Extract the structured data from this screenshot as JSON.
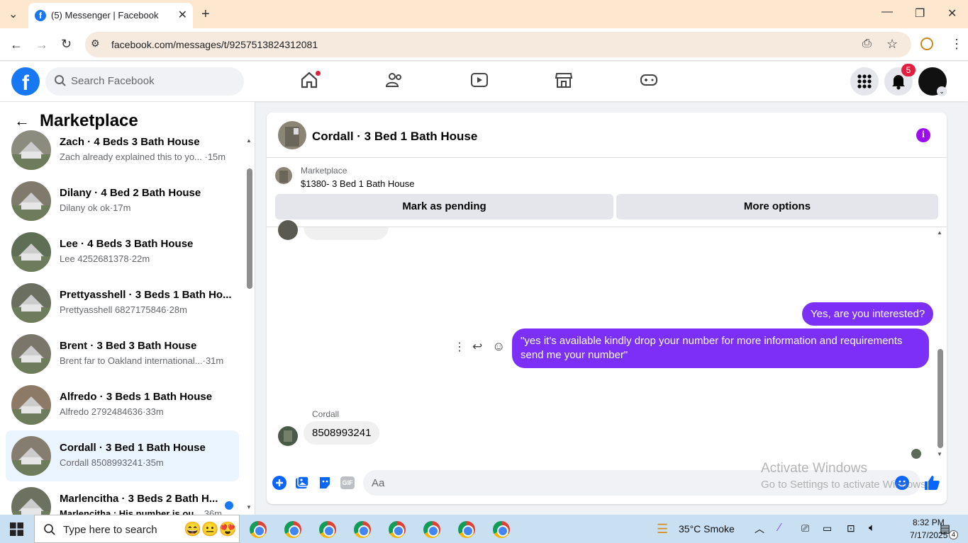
{
  "browser": {
    "tab_title": "(5) Messenger | Facebook",
    "url": "facebook.com/messages/t/9257513824312081"
  },
  "fb": {
    "search_placeholder": "Search Facebook",
    "notification_count": "5"
  },
  "sidebar": {
    "title": "Marketplace",
    "conversations": [
      {
        "name": "Zach · 4 Beds 3 Bath House",
        "preview": "Zach already explained this to yo... ·15m"
      },
      {
        "name": "Dilany · 4 Bed 2 Bath House",
        "preview": "Dilany ok ok·17m"
      },
      {
        "name": "Lee · 4 Beds 3 Bath House",
        "preview": "Lee 4252681378·22m"
      },
      {
        "name": "Prettyasshell · 3 Beds 1 Bath Ho...",
        "preview": "Prettyasshell 6827175846·28m"
      },
      {
        "name": "Brent · 3 Bed 3 Bath House",
        "preview": "Brent far to Oakland international...·31m"
      },
      {
        "name": "Alfredo · 3 Beds 1 Bath House",
        "preview": "Alfredo 2792484636·33m"
      },
      {
        "name": "Cordall · 3 Bed 1 Bath House",
        "preview": "Cordall 8508993241·35m"
      },
      {
        "name": "Marlencitha · 3 Beds 2 Bath H...",
        "preview": "Marlencitha : His number is ou...",
        "time": "36m"
      }
    ]
  },
  "chat": {
    "title": "Cordall · 3 Bed 1 Bath House",
    "marketplace_label": "Marketplace",
    "listing": "$1380- 3 Bed 1 Bath House",
    "mark_pending": "Mark as pending",
    "more_options": "More options",
    "messages": {
      "out1": "Yes, are you interested?",
      "out2": "\"yes it's available kindly drop your number for more information and requirements send me your number\"",
      "sender": "Cordall",
      "in1": "8508993241"
    },
    "composer_placeholder": "Aa",
    "gif_label": "GIF"
  },
  "watermark": {
    "line1": "Activate Windows",
    "line2": "Go to Settings to activate Windows."
  },
  "taskbar": {
    "search_placeholder": "Type here to search",
    "weather": "35°C  Smoke",
    "time": "8:32 PM",
    "date": "7/17/2025",
    "notif_count": "4"
  }
}
